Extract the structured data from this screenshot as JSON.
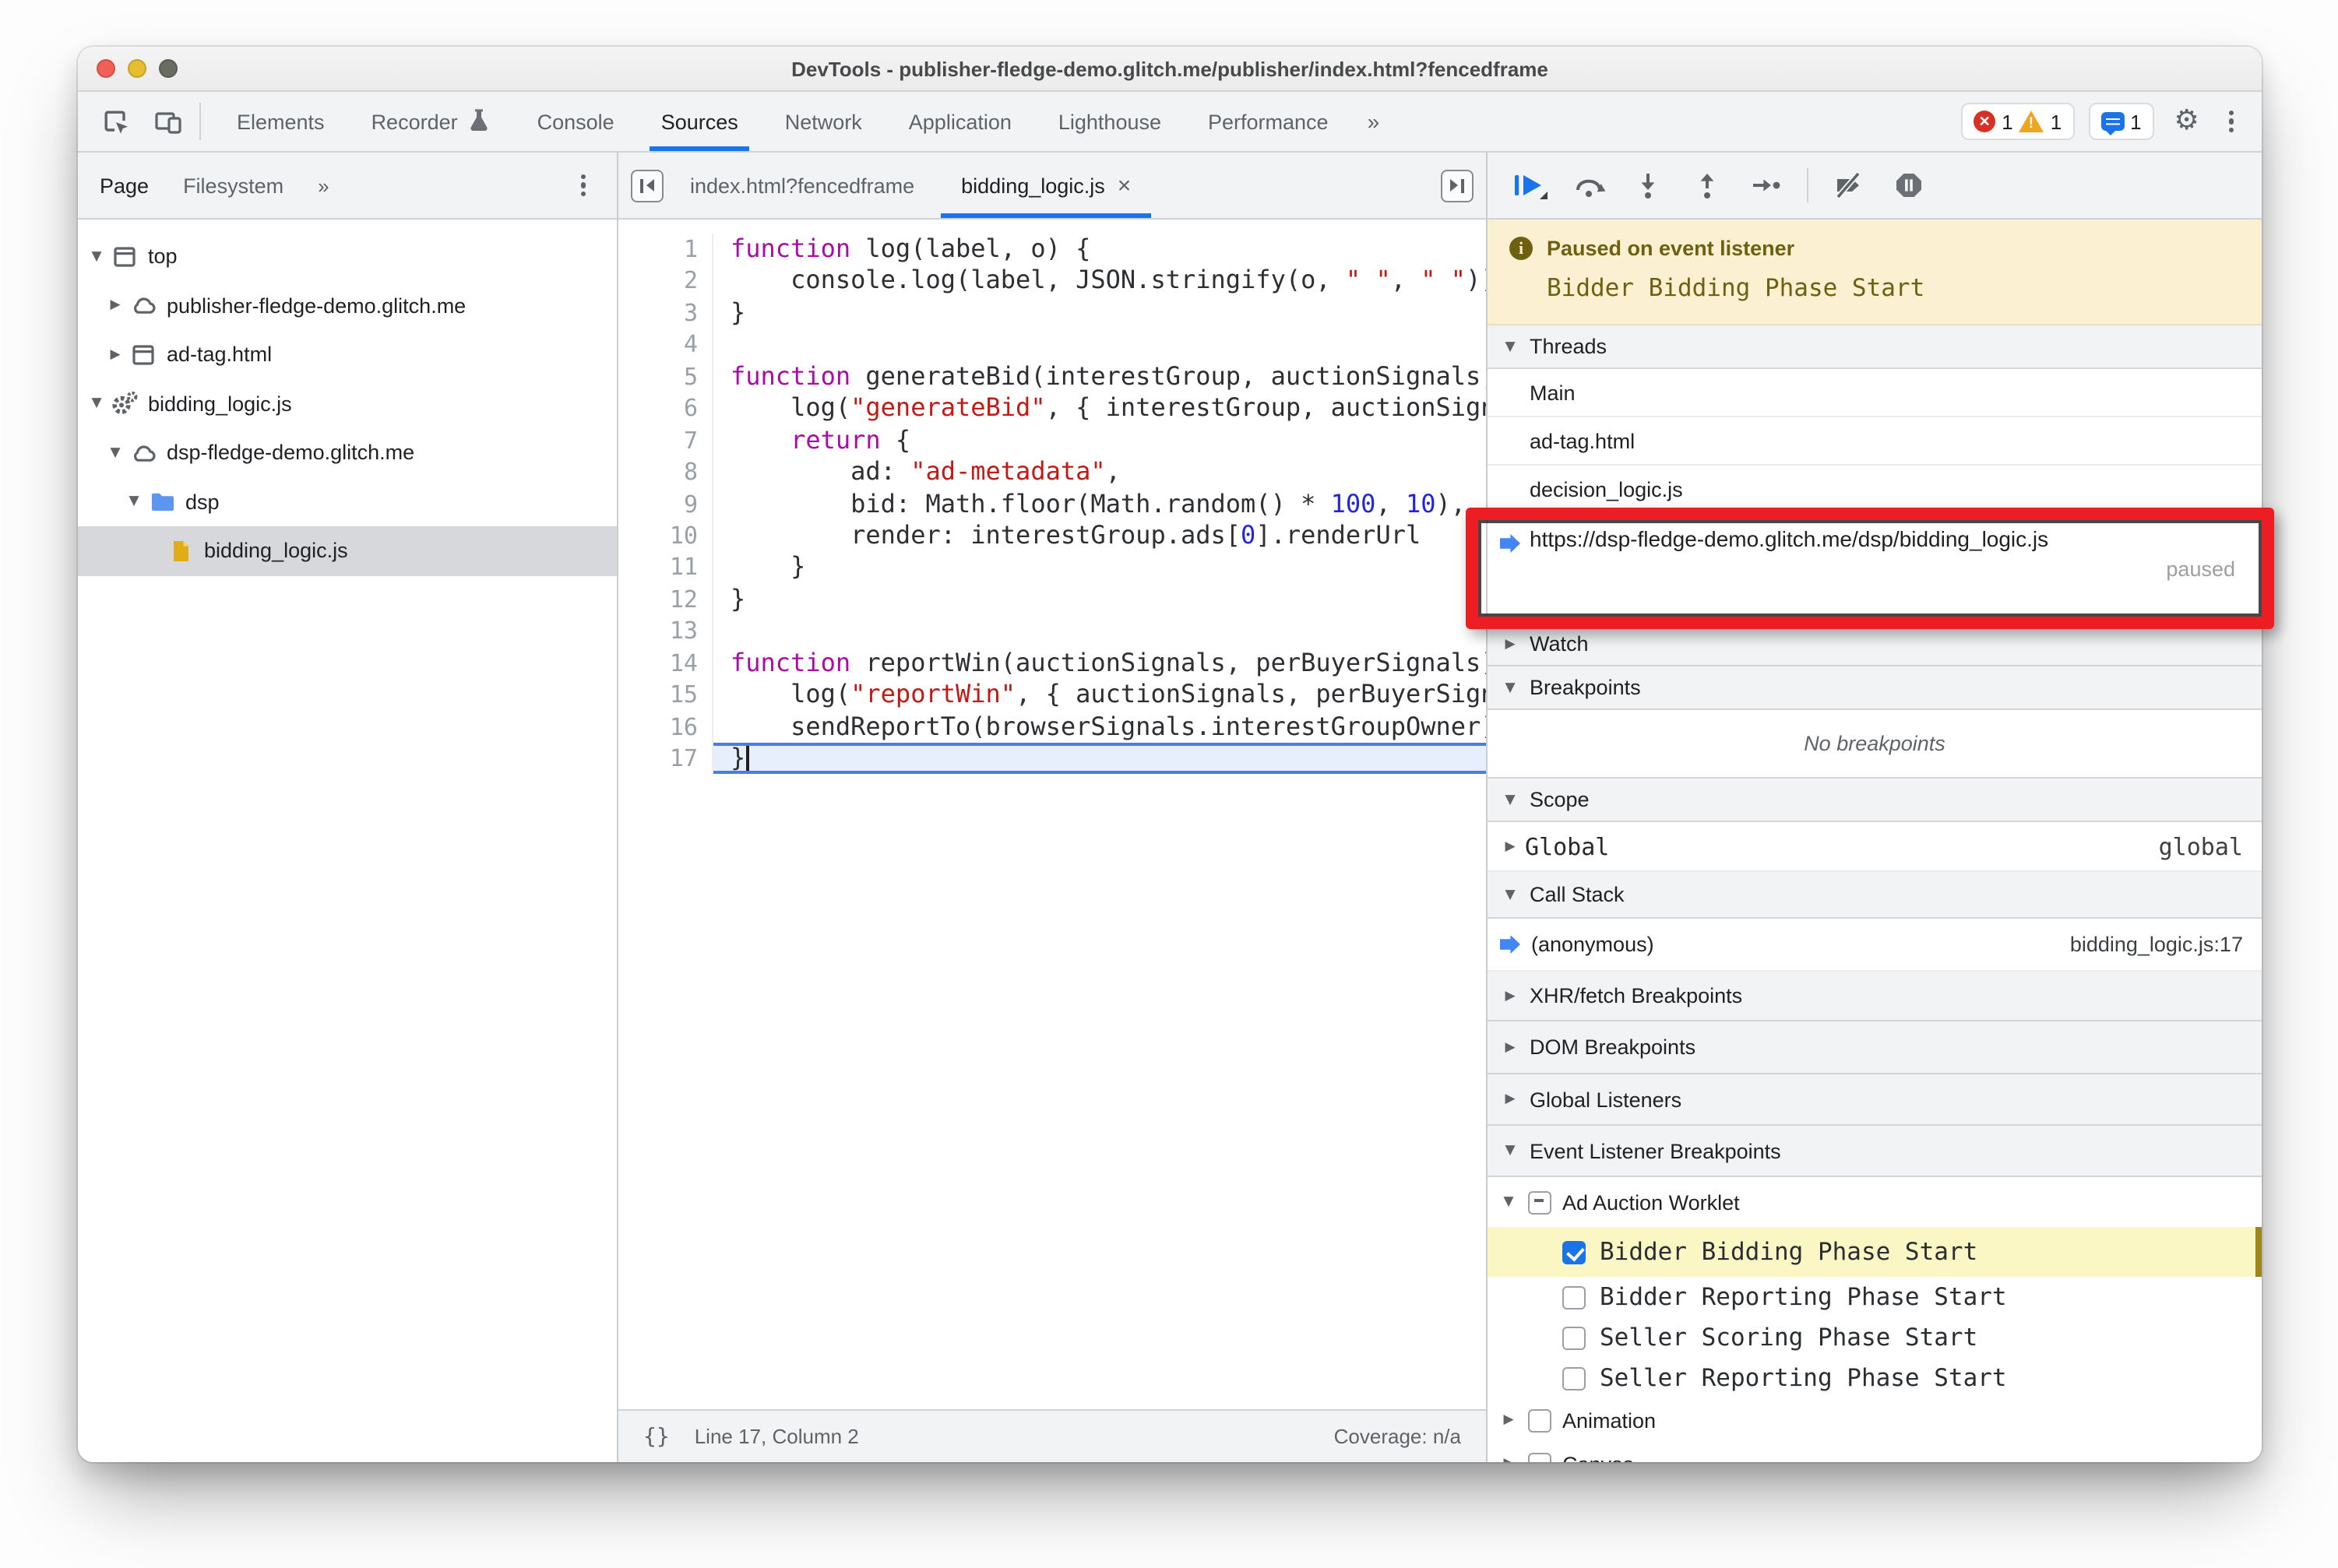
{
  "window": {
    "title": "DevTools - publisher-fledge-demo.glitch.me/publisher/index.html?fencedframe"
  },
  "main_tabs": {
    "items": [
      {
        "label": "Elements"
      },
      {
        "label": "Recorder",
        "icon": "flask"
      },
      {
        "label": "Console"
      },
      {
        "label": "Sources",
        "active": true
      },
      {
        "label": "Network"
      },
      {
        "label": "Application"
      },
      {
        "label": "Lighthouse"
      },
      {
        "label": "Performance"
      }
    ],
    "more_chevron": "»"
  },
  "badges": {
    "errors": "1",
    "warnings": "1",
    "issues": "1"
  },
  "sidebar": {
    "tabs": [
      {
        "label": "Page",
        "active": true
      },
      {
        "label": "Filesystem",
        "active": false
      }
    ],
    "more_chevron": "»",
    "tree": [
      {
        "label": "top",
        "icon": "frame",
        "level": 0,
        "exp": "open"
      },
      {
        "label": "publisher-fledge-demo.glitch.me",
        "icon": "cloud",
        "level": 1,
        "exp": "closed"
      },
      {
        "label": "ad-tag.html",
        "icon": "frame",
        "level": 1,
        "exp": "closed"
      },
      {
        "label": "bidding_logic.js",
        "icon": "worker",
        "level": 0,
        "exp": "open"
      },
      {
        "label": "dsp-fledge-demo.glitch.me",
        "icon": "cloud",
        "level": 1,
        "exp": "open"
      },
      {
        "label": "dsp",
        "icon": "folder",
        "level": 2,
        "exp": "open"
      },
      {
        "label": "bidding_logic.js",
        "icon": "file",
        "level": 3,
        "exp": "none",
        "selected": true
      }
    ]
  },
  "editor": {
    "tabs": [
      {
        "label": "index.html?fencedframe",
        "active": false
      },
      {
        "label": "bidding_logic.js",
        "active": true,
        "close": "×"
      }
    ],
    "execution_line": 17,
    "lines": [
      {
        "n": "1",
        "tokens": [
          [
            "function",
            "k"
          ],
          [
            " log(label, o) {",
            "d"
          ]
        ]
      },
      {
        "n": "2",
        "tokens": [
          [
            "    console.log(label, JSON.stringify(o, ",
            "d"
          ],
          [
            "\" \"",
            "s"
          ],
          [
            ", ",
            "d"
          ],
          [
            "\" \"",
            "s"
          ],
          [
            "));",
            "d"
          ]
        ]
      },
      {
        "n": "3",
        "tokens": [
          [
            "}",
            "d"
          ]
        ]
      },
      {
        "n": "4",
        "tokens": []
      },
      {
        "n": "5",
        "tokens": [
          [
            "function",
            "k"
          ],
          [
            " generateBid(interestGroup, auctionSignals, perBuyerSignals) {",
            "d"
          ]
        ]
      },
      {
        "n": "6",
        "tokens": [
          [
            "    log(",
            "d"
          ],
          [
            "\"generateBid\"",
            "s"
          ],
          [
            ", { interestGroup, auctionSignals });",
            "d"
          ]
        ]
      },
      {
        "n": "7",
        "tokens": [
          [
            "    ",
            "d"
          ],
          [
            "return",
            "k"
          ],
          [
            " {",
            "d"
          ]
        ]
      },
      {
        "n": "8",
        "tokens": [
          [
            "        ad: ",
            "d"
          ],
          [
            "\"ad-metadata\"",
            "s"
          ],
          [
            ",",
            "d"
          ]
        ]
      },
      {
        "n": "9",
        "tokens": [
          [
            "        bid: Math.floor(Math.random() * ",
            "d"
          ],
          [
            "100",
            "n"
          ],
          [
            ", ",
            "d"
          ],
          [
            "10",
            "n"
          ],
          [
            "),",
            "d"
          ]
        ]
      },
      {
        "n": "10",
        "tokens": [
          [
            "        render: interestGroup.ads[",
            "d"
          ],
          [
            "0",
            "n"
          ],
          [
            "].renderUrl",
            "d"
          ]
        ]
      },
      {
        "n": "11",
        "tokens": [
          [
            "    }",
            "d"
          ]
        ]
      },
      {
        "n": "12",
        "tokens": [
          [
            "}",
            "d"
          ]
        ]
      },
      {
        "n": "13",
        "tokens": []
      },
      {
        "n": "14",
        "tokens": [
          [
            "function",
            "k"
          ],
          [
            " reportWin(auctionSignals, perBuyerSignals) {",
            "d"
          ]
        ]
      },
      {
        "n": "15",
        "tokens": [
          [
            "    log(",
            "d"
          ],
          [
            "\"reportWin\"",
            "s"
          ],
          [
            ", { auctionSignals, perBuyerSignals });",
            "d"
          ]
        ]
      },
      {
        "n": "16",
        "tokens": [
          [
            "    sendReportTo(browserSignals.interestGroupOwner);",
            "d"
          ]
        ]
      },
      {
        "n": "17",
        "tokens": [
          [
            "}",
            "d"
          ]
        ]
      }
    ],
    "status": {
      "brace_icon": "{}",
      "position": "Line 17, Column 2",
      "coverage": "Coverage: n/a"
    }
  },
  "debugger": {
    "paused_banner": {
      "info_icon": "i",
      "title": "Paused on event listener",
      "subtitle": "Bidder Bidding Phase Start"
    },
    "threads": {
      "header": "Threads",
      "items": [
        "Main",
        "ad-tag.html",
        "decision_logic.js"
      ],
      "selected": {
        "url": "https://dsp-fledge-demo.glitch.me/dsp/bidding_logic.js",
        "status": "paused"
      }
    },
    "watch": {
      "header": "Watch"
    },
    "breakpoints": {
      "header": "Breakpoints",
      "empty_message": "No breakpoints"
    },
    "scope": {
      "header": "Scope",
      "entries": [
        {
          "name": "Global",
          "annotation": "global"
        }
      ]
    },
    "call_stack": {
      "header": "Call Stack",
      "frames": [
        {
          "name": "(anonymous)",
          "location": "bidding_logic.js:17"
        }
      ]
    },
    "collapsed_sections": [
      {
        "label": "XHR/fetch Breakpoints"
      },
      {
        "label": "DOM Breakpoints"
      },
      {
        "label": "Global Listeners"
      }
    ],
    "event_listener_breakpoints": {
      "header": "Event Listener Breakpoints",
      "categories": [
        {
          "label": "Ad Auction Worklet",
          "checkbox": "indeterminate",
          "expanded": true,
          "worklet": true,
          "items": [
            {
              "label": "Bidder Bidding Phase Start",
              "checked": true,
              "highlighted": true
            },
            {
              "label": "Bidder Reporting Phase Start",
              "checked": false
            },
            {
              "label": "Seller Scoring Phase Start",
              "checked": false
            },
            {
              "label": "Seller Reporting Phase Start",
              "checked": false
            }
          ]
        },
        {
          "label": "Animation",
          "checkbox": "unchecked",
          "expanded": false,
          "items": []
        },
        {
          "label": "Canvas",
          "checkbox": "unchecked",
          "expanded": false,
          "items": []
        }
      ]
    }
  },
  "colors": {
    "accent_blue": "#1a73e8",
    "exec_arrow_blue": "#4285f4",
    "annotation_red": "#ec1e24",
    "error_red": "#d93025",
    "warning_yellow": "#f0a61c",
    "banner_bg": "#fbf1d2",
    "banner_text": "#6d6111",
    "highlight_yellow": "#fbf7c5",
    "keyword_purple": "#aa0da5",
    "string_red": "#c41a16",
    "number_blue": "#2424dd",
    "folder_blue": "#5b97f0",
    "file_yellow": "#e2ac18",
    "selected_row_gray": "#d6d8db"
  }
}
